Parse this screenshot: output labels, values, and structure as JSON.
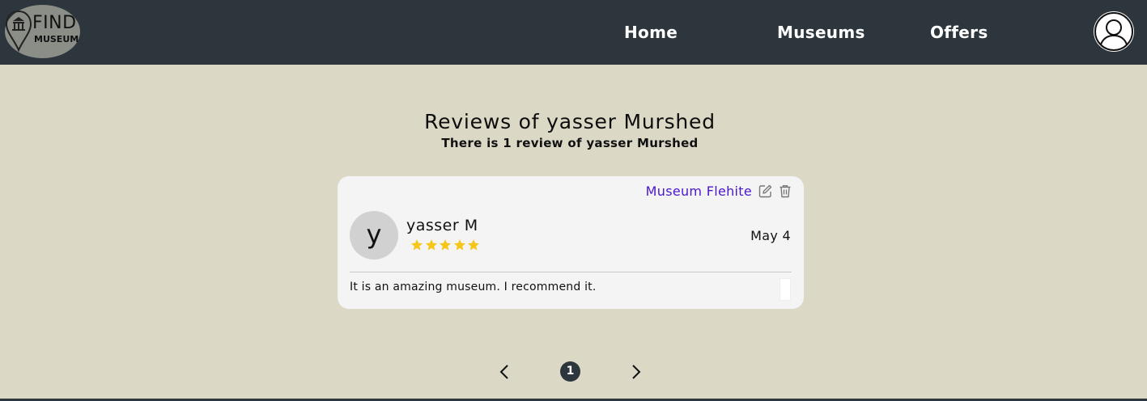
{
  "header": {
    "logo": {
      "line1": "FIND",
      "line2": "MUSEUM",
      "icon": "museum-pin-icon"
    },
    "nav": [
      {
        "label": "Home"
      },
      {
        "label": "Museums"
      },
      {
        "label": "Offers"
      }
    ],
    "profile_icon": "user-profile-icon"
  },
  "main": {
    "title": "Reviews of yasser Murshed",
    "subtitle": "There is 1 review of yasser Murshed",
    "reviews": [
      {
        "museum": "Museum Flehite",
        "avatar_initial": "y",
        "author": "yasser M",
        "rating": 5,
        "rating_max": 5,
        "date": "May 4",
        "text": "It is an amazing museum. I recommend it.",
        "icons": {
          "edit": "edit-icon",
          "delete": "trash-icon"
        }
      }
    ]
  },
  "pagination": {
    "current_page": "1",
    "prev_icon": "chevron-left-icon",
    "next_icon": "chevron-right-icon"
  },
  "colors": {
    "navbar": "#2c363c",
    "background": "#dbd8c6",
    "card": "#f4f4f4",
    "link": "#4a17c9",
    "star": "#f5c518"
  }
}
